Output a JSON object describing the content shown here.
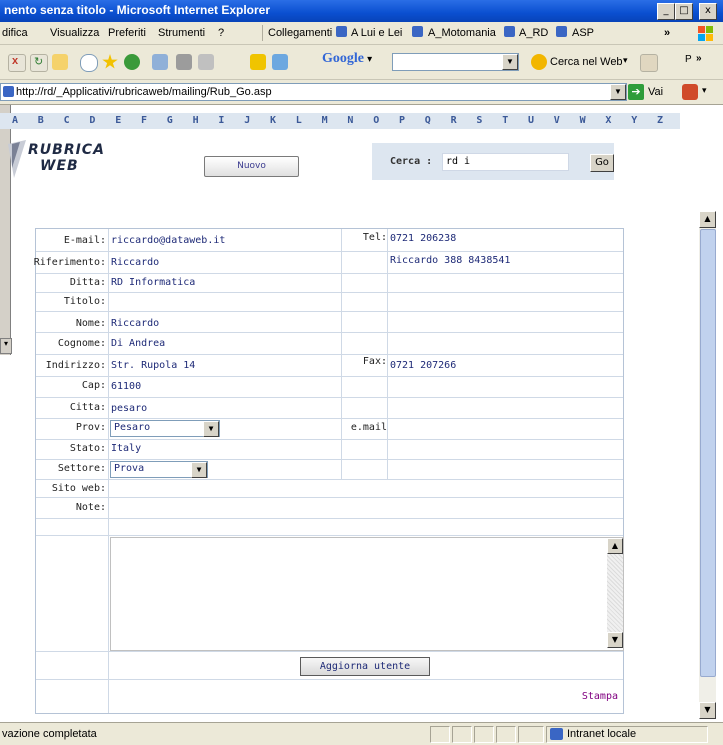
{
  "window": {
    "title": "nento senza titolo - Microsoft Internet Explorer",
    "buttons": {
      "min": "_",
      "max": "□",
      "close": "x"
    }
  },
  "menu": {
    "items": [
      "difica",
      "Visualizza",
      "Preferiti",
      "Strumenti",
      "?"
    ],
    "links_label": "Collegamenti",
    "links": [
      "A Lui e Lei",
      "A_Motomania",
      "A_RD",
      "ASP"
    ],
    "chevron": "»"
  },
  "toolbar": {
    "google_label": "Google",
    "cerca_label": "Cerca nel Web",
    "extra": "P"
  },
  "address": {
    "url": "http://rd/_Applicativi/rubricaweb/mailing/Rub_Go.asp",
    "go_label": "Vai"
  },
  "alphabet": [
    "A",
    "B",
    "C",
    "D",
    "E",
    "F",
    "G",
    "H",
    "I",
    "J",
    "K",
    "L",
    "M",
    "N",
    "O",
    "P",
    "Q",
    "R",
    "S",
    "T",
    "U",
    "V",
    "W",
    "X",
    "Y",
    "Z"
  ],
  "header": {
    "logo_line1": "RUBRICA",
    "logo_line2": "WEB",
    "new_button": "Nuovo",
    "search_label": "Cerca :",
    "search_value": "rd i",
    "go_button": "Go"
  },
  "form": {
    "labels": {
      "email": "E-mail:",
      "riferimento": "Riferimento:",
      "ditta": "Ditta:",
      "titolo": "Titolo:",
      "nome": "Nome:",
      "cognome": "Cognome:",
      "indirizzo": "Indirizzo:",
      "cap": "Cap:",
      "citta": "Citta:",
      "prov": "Prov:",
      "stato": "Stato:",
      "settore": "Settore:",
      "sito": "Sito web:",
      "note": "Note:",
      "tel": "Tel:",
      "fax": "Fax:",
      "email2": "e.mail"
    },
    "values": {
      "email": "riccardo@dataweb.it",
      "riferimento": "Riccardo",
      "ditta": "RD Informatica",
      "titolo": "",
      "nome": "Riccardo",
      "cognome": "Di Andrea",
      "indirizzo": "Str. Rupola 14",
      "cap": "61100",
      "citta": "pesaro",
      "prov": "Pesaro",
      "stato": "Italy",
      "settore": "Prova",
      "sito": "",
      "note": "",
      "tel": "0721 206238",
      "tel2": "Riccardo 388 8438541",
      "fax": "0721 207266"
    },
    "update_button": "Aggiorna utente",
    "print_link": "Stampa"
  },
  "status": {
    "text": "vazione completata",
    "zone": "Intranet locale"
  },
  "colors": {
    "titlebar": "#0a4fd0",
    "chrome": "#ece9d8",
    "accent_text": "#1e2a77",
    "panel": "#dde6f0",
    "link_visited": "#800080"
  }
}
